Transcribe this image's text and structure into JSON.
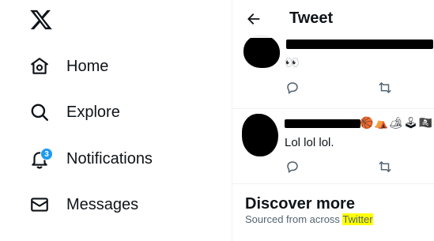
{
  "sidebar": {
    "logo": "x-logo-icon",
    "items": [
      {
        "label": "Home",
        "icon": "home-icon"
      },
      {
        "label": "Explore",
        "icon": "search-icon"
      },
      {
        "label": "Notifications",
        "icon": "bell-icon",
        "badge": "3"
      },
      {
        "label": "Messages",
        "icon": "envelope-icon"
      }
    ]
  },
  "header": {
    "title": "Tweet"
  },
  "tweets": [
    {
      "text": "👀",
      "actions": [
        "reply-icon",
        "retweet-icon"
      ]
    },
    {
      "text": "Lol lol lol.",
      "emojis": [
        "🏀",
        "⛺",
        "🏕",
        "🕹",
        "🏴‍☠️",
        "🌞"
      ],
      "actions": [
        "reply-icon",
        "retweet-icon"
      ]
    }
  ],
  "discover": {
    "title": "Discover more",
    "subtitle_prefix": "Sourced from across ",
    "subtitle_link": "Twitter"
  },
  "colors": {
    "accent": "#1d9bf0",
    "text": "#0f1419",
    "muted": "#536471",
    "highlight": "#ffff00"
  }
}
